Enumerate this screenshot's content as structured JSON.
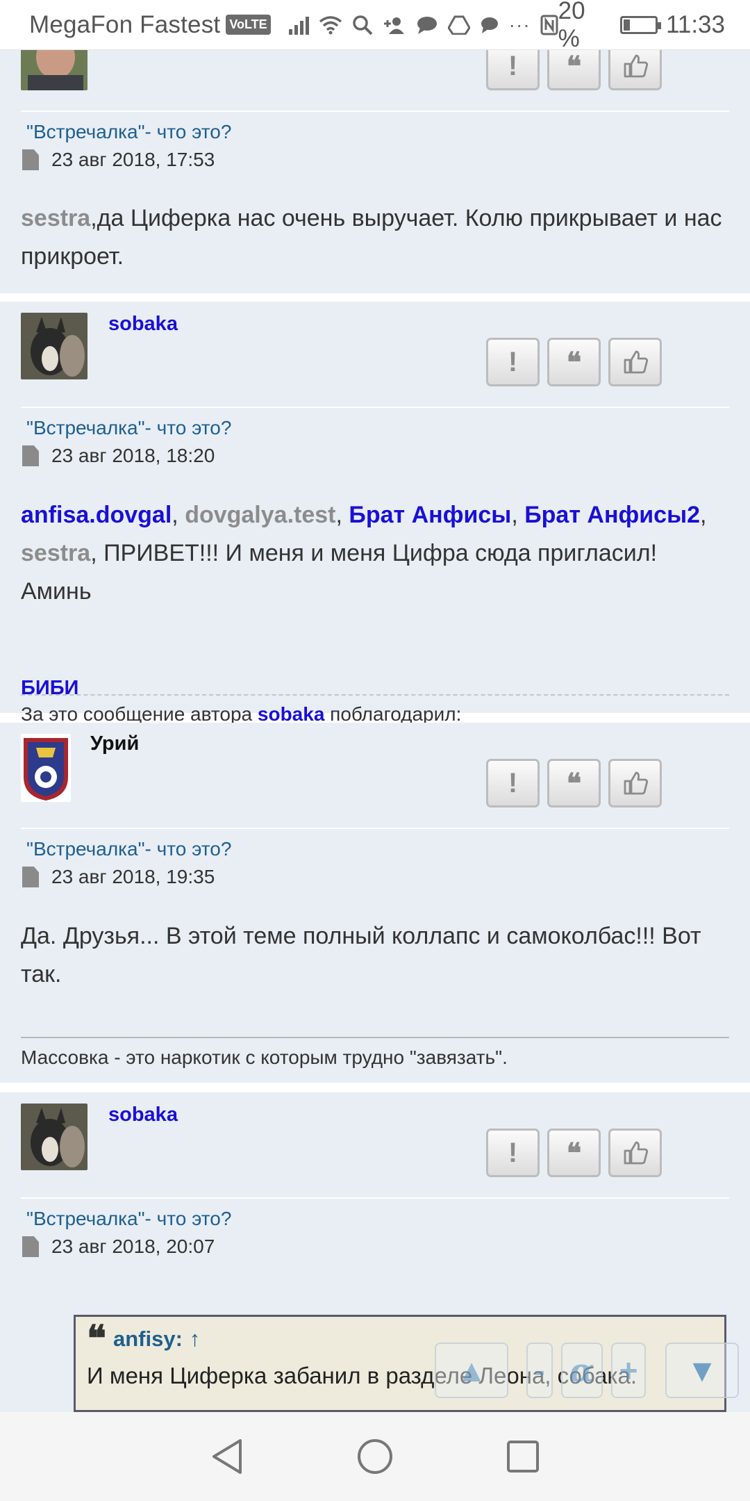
{
  "status_bar": {
    "carrier": "MegaFon Fastest",
    "volte": "VoLTE",
    "battery": "20 %",
    "battery_level": 0.2,
    "time": "11:33",
    "icons": [
      "signal-icon",
      "wifi-icon",
      "search-icon",
      "add-contact-icon",
      "chat-icon",
      "drive-icon",
      "message-icon",
      "more-icon",
      "nfc-icon",
      "battery-icon"
    ]
  },
  "posts": [
    {
      "topic": "\"Встречалка\"- что это?",
      "date": "23 авг 2018, 17:53",
      "message": {
        "mention": "sestra",
        "text": ",да Циферка нас очень выручает. Колю прикрывает и нас прикроет."
      }
    },
    {
      "author": "sobaka",
      "topic": "\"Встречалка\"- что это?",
      "date": "23 авг 2018, 18:20",
      "message": {
        "m1": "anfisa.dovgal",
        "c1": ", ",
        "m2": "dovgalya.test",
        "c2": ", ",
        "m3": "Брат Анфисы",
        "c3": ", ",
        "m4": "Брат Анфисы2",
        "c4": ", ",
        "m5": "sestra",
        "text": ", ПРИВЕТ!!! И меня и меня Цифра сюда пригласил! Аминь"
      },
      "thanks_prefix": "За это сообщение автора",
      "thanks_author": "sobaka",
      "thanks_suffix": "поблагодарил:",
      "thanks_user": "БИБИ"
    },
    {
      "author": "Урий",
      "topic": "\"Встречалка\"- что это?",
      "date": "23 авг 2018, 19:35",
      "message": {
        "text": "Да. Друзья... В этой теме полный коллапс и самоколбас!!! Вот так."
      },
      "signature": "Массовка - это наркотик с которым трудно \"завязать\"."
    },
    {
      "author": "sobaka",
      "topic": "\"Встречалка\"- что это?",
      "date": "23 авг 2018, 20:07",
      "quote": {
        "author": "anfisy:",
        "arrow": "↑",
        "text": "И меня Циферка забанил в разделе Леона, собака."
      }
    }
  ],
  "post_buttons": {
    "report": "!",
    "quote": "❝",
    "like": "👍"
  },
  "floating": {
    "up": "▲",
    "font_minus": "-",
    "font_label": "α",
    "font_plus": "+",
    "down": "▼"
  }
}
